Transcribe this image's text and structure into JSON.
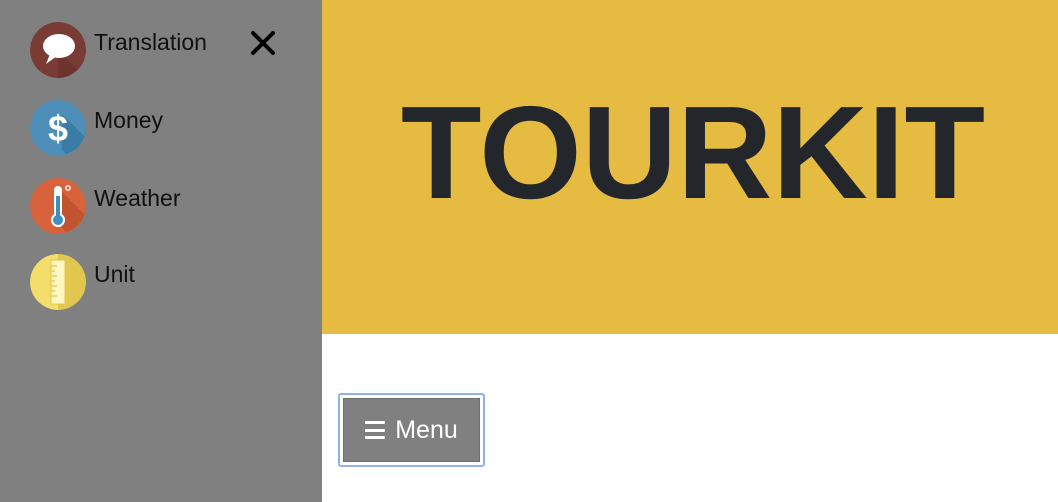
{
  "sidebar": {
    "close_icon": "close-icon",
    "items": [
      {
        "label": "Translation",
        "icon": "speech-bubble-icon",
        "color": "#7a3b34"
      },
      {
        "label": "Money",
        "icon": "dollar-icon",
        "color": "#4d8fb9"
      },
      {
        "label": "Weather",
        "icon": "thermometer-icon",
        "color": "#d7623c"
      },
      {
        "label": "Unit",
        "icon": "ruler-icon",
        "color": "#f3de6b"
      }
    ]
  },
  "hero": {
    "title": "TOURKIT",
    "background": "#e5bb42",
    "text_color": "#23272b"
  },
  "menu_button": {
    "label": "Menu",
    "icon": "hamburger-icon",
    "focus_ring_color": "#8fb2ee"
  },
  "colors": {
    "sidebar_background": "#808080",
    "page_background": "#ffffff"
  }
}
